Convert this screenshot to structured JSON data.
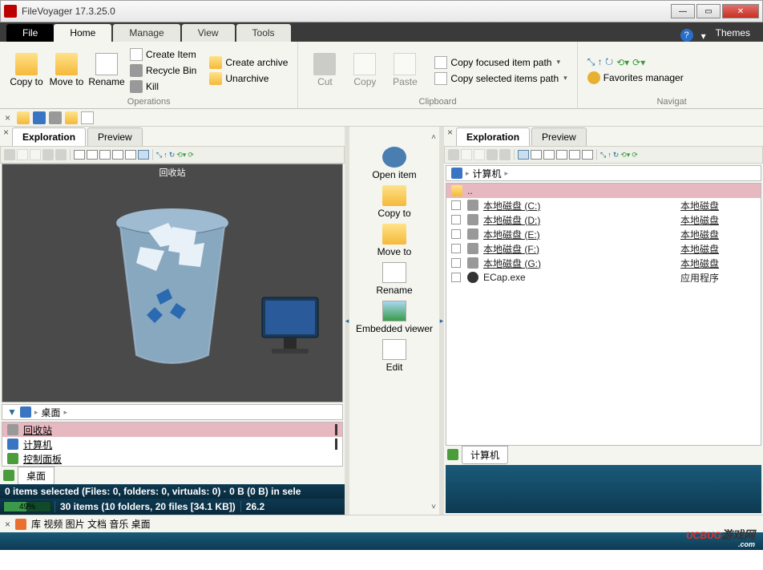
{
  "window": {
    "title": "FileVoyager 17.3.25.0"
  },
  "ribbon": {
    "tabs": {
      "file": "File",
      "home": "Home",
      "manage": "Manage",
      "view": "View",
      "tools": "Tools"
    },
    "themes": "Themes",
    "groups": {
      "g1": {
        "copy_to": "Copy\nto",
        "move_to": "Move\nto",
        "rename": "Rename",
        "create_item": "Create Item",
        "recycle_bin": "Recycle Bin",
        "kill": "Kill",
        "create_archive": "Create archive",
        "unarchive": "Unarchive",
        "label": "Operations"
      },
      "clipboard": {
        "cut": "Cut",
        "copy": "Copy",
        "paste": "Paste",
        "focused": "Copy focused item path",
        "selected": "Copy selected items path",
        "label": "Clipboard"
      },
      "nav": {
        "fav": "Favorites manager",
        "label": "Navigat"
      }
    }
  },
  "left": {
    "tabs": {
      "exploration": "Exploration",
      "preview": "Preview"
    },
    "caption": "回收站",
    "breadcrumb": {
      "item": "桌面"
    },
    "rows": [
      {
        "name": "回收站"
      },
      {
        "name": "计算机"
      },
      {
        "name": "控制面板"
      }
    ],
    "foldertab": "桌面",
    "status1": "0 items selected (Files: 0, folders: 0, virtuals: 0) · 0 B (0 B) in sele",
    "status2": {
      "pct": "49%",
      "text": "30 items (10 folders, 20 files [34.1 KB])",
      "extra": "26.2"
    }
  },
  "center": {
    "open": "Open item",
    "copy": "Copy to",
    "move": "Move to",
    "rename": "Rename",
    "viewer": "Embedded viewer",
    "edit": "Edit"
  },
  "right": {
    "tabs": {
      "exploration": "Exploration",
      "preview": "Preview"
    },
    "breadcrumb": {
      "item": "计算机"
    },
    "up": "..",
    "rows": [
      {
        "name": "本地磁盘 (C:)",
        "type": "本地磁盘"
      },
      {
        "name": "本地磁盘 (D:)",
        "type": "本地磁盘"
      },
      {
        "name": "本地磁盘 (E:)",
        "type": "本地磁盘"
      },
      {
        "name": "本地磁盘 (F:)",
        "type": "本地磁盘"
      },
      {
        "name": "本地磁盘 (G:)",
        "type": "本地磁盘"
      },
      {
        "name": "ECap.exe",
        "type": "应用程序"
      }
    ],
    "foldertab": "计算机"
  },
  "lib": {
    "text": "库  视频  图片  文档  音乐  桌面"
  },
  "watermark": {
    "brand": "UCBUG",
    "cn": "游戏网",
    "com": ".com"
  }
}
